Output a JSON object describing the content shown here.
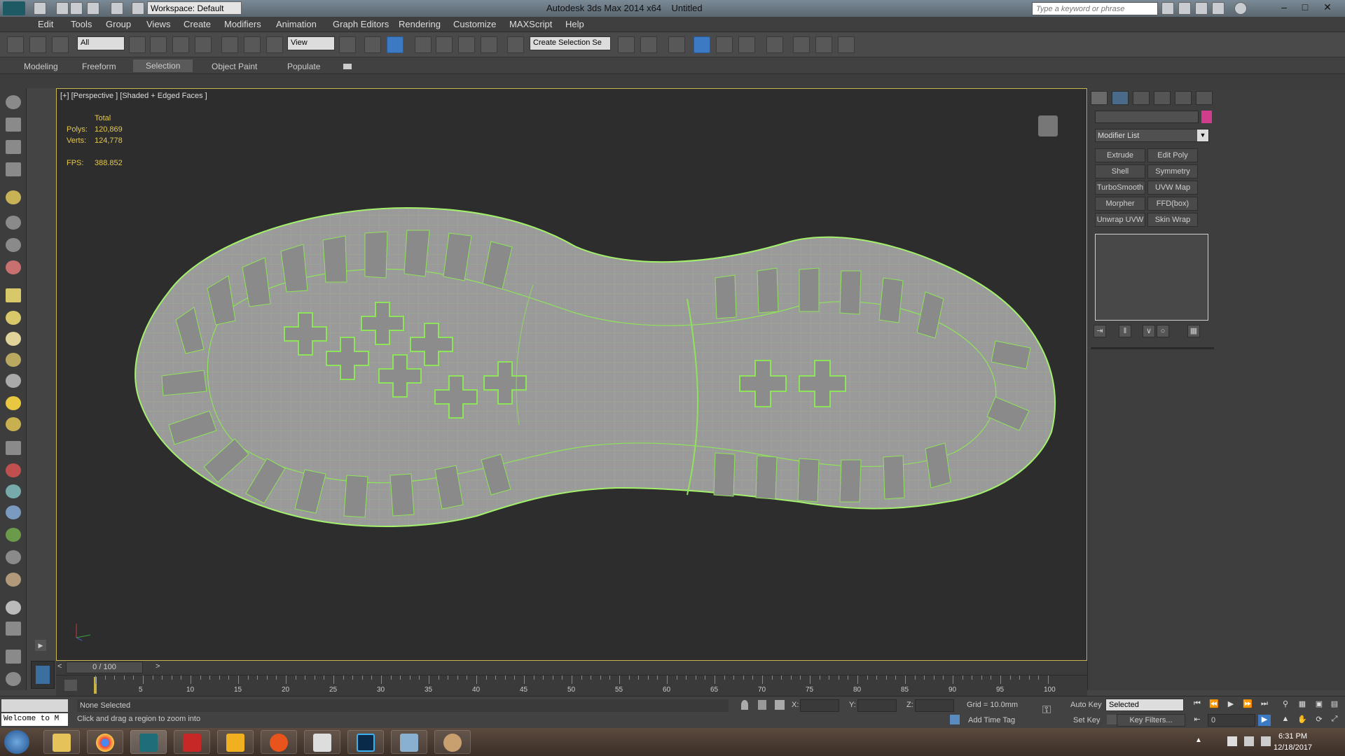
{
  "titlebar": {
    "app_title": "Autodesk 3ds Max 2014 x64",
    "doc_title": "Untitled",
    "workspace": "Workspace: Default",
    "search_placeholder": "Type a keyword or phrase"
  },
  "menu": [
    "Edit",
    "Tools",
    "Group",
    "Views",
    "Create",
    "Modifiers",
    "Animation",
    "Graph Editors",
    "Rendering",
    "Customize",
    "MAXScript",
    "Help"
  ],
  "toolbar": {
    "selection_filter": "All",
    "ref_coord": "View",
    "named_selection": "Create Selection Se"
  },
  "ribbon": {
    "tabs": [
      "Modeling",
      "Freeform",
      "Selection",
      "Object Paint",
      "Populate"
    ],
    "active_tab": "Selection"
  },
  "viewport": {
    "label": "[+] [Perspective ] [Shaded + Edged Faces ]",
    "stats_header": "Total",
    "polys_label": "Polys:",
    "polys_value": "120,869",
    "verts_label": "Verts:",
    "verts_value": "124,778",
    "fps_label": "FPS:",
    "fps_value": "388.852",
    "mesh_color": "#8fe35a"
  },
  "command_panel": {
    "modifier_list": "Modifier List",
    "modifier_buttons": [
      "Extrude",
      "Edit Poly",
      "Shell",
      "Symmetry",
      "TurboSmooth",
      "UVW Map",
      "Morpher",
      "FFD(box)",
      "Unwrap UVW",
      "Skin Wrap"
    ],
    "object_color": "#d23c8c"
  },
  "timeslider": {
    "frame_display": "0 / 100",
    "ticks": [
      "5",
      "10",
      "15",
      "20",
      "25",
      "30",
      "35",
      "40",
      "45",
      "50",
      "55",
      "60",
      "65",
      "70",
      "75",
      "80",
      "85",
      "90",
      "95",
      "100"
    ]
  },
  "status": {
    "listener_text": "Welcome to M",
    "selection_text": "None Selected",
    "prompt_text": "Click and drag a region to zoom into",
    "x_label": "X:",
    "y_label": "Y:",
    "z_label": "Z:",
    "grid_text": "Grid = 10.0mm",
    "add_time_tag": "Add Time Tag",
    "auto_key": "Auto Key",
    "set_key": "Set Key",
    "selected_dropdown": "Selected",
    "key_filters": "Key Filters...",
    "current_frame": "0"
  },
  "taskbar": {
    "time": "6:31 PM",
    "date": "12/18/2017"
  }
}
